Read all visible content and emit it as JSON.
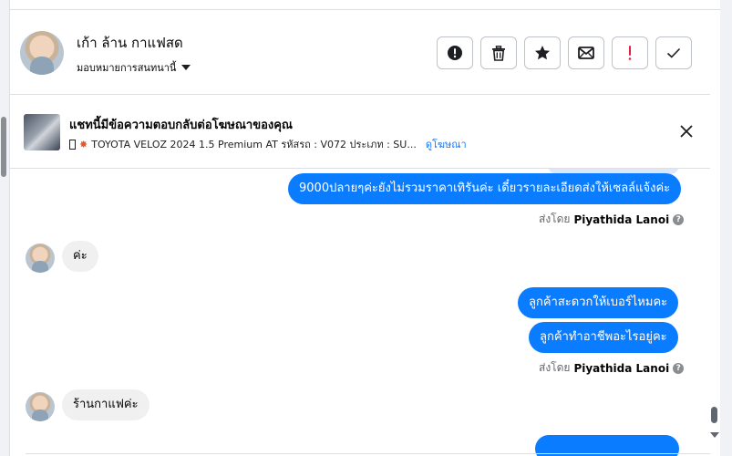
{
  "header": {
    "contact_name": "เก้า ล้าน กาแฟสด",
    "assign_label": "มอบหมายการสนทนานี้",
    "actions": [
      {
        "icon": "alert-circle-icon",
        "tooltip": ""
      },
      {
        "icon": "trash-icon",
        "tooltip": ""
      },
      {
        "icon": "star-icon",
        "tooltip": ""
      },
      {
        "icon": "mail-icon",
        "tooltip": ""
      },
      {
        "icon": "exclamation-icon",
        "tooltip": ""
      },
      {
        "icon": "check-icon",
        "tooltip": ""
      }
    ]
  },
  "ad": {
    "title": "แชทนี้มีข้อความตอบกลับต่อโฆษณาของคุณ",
    "subtitle": "TOYOTA VELOZ 2024 1.5 Premium AT รหัสรถ : V072 ประเภท : SU...",
    "link": "ดูโฆษณา"
  },
  "messages": {
    "m1": "9000ปลายๆค่ะยังไม่รวมราคาเทิรันค่ะ เดี๋ยวรายละเอียดส่งให้เซลล์แจ้งค่ะ",
    "sent1_prefix": "ส่งโดย",
    "sent1_name": "Piyathida Lanoi",
    "m2": "ค่ะ",
    "m3": "ลูกค้าสะดวกให้เบอร์ไหมคะ",
    "m4": "ลูกค้าทำอาชีพอะไรอยู่คะ",
    "sent2_prefix": "ส่งโดย",
    "sent2_name": "Piyathida Lanoi",
    "m5": "ร้านกาแฟค่ะ"
  },
  "colors": {
    "outgoing_bubble": "#0a7cff",
    "incoming_bubble": "#f0f0f0",
    "alert_red": "#e41e3f",
    "link_blue": "#1877f2"
  }
}
